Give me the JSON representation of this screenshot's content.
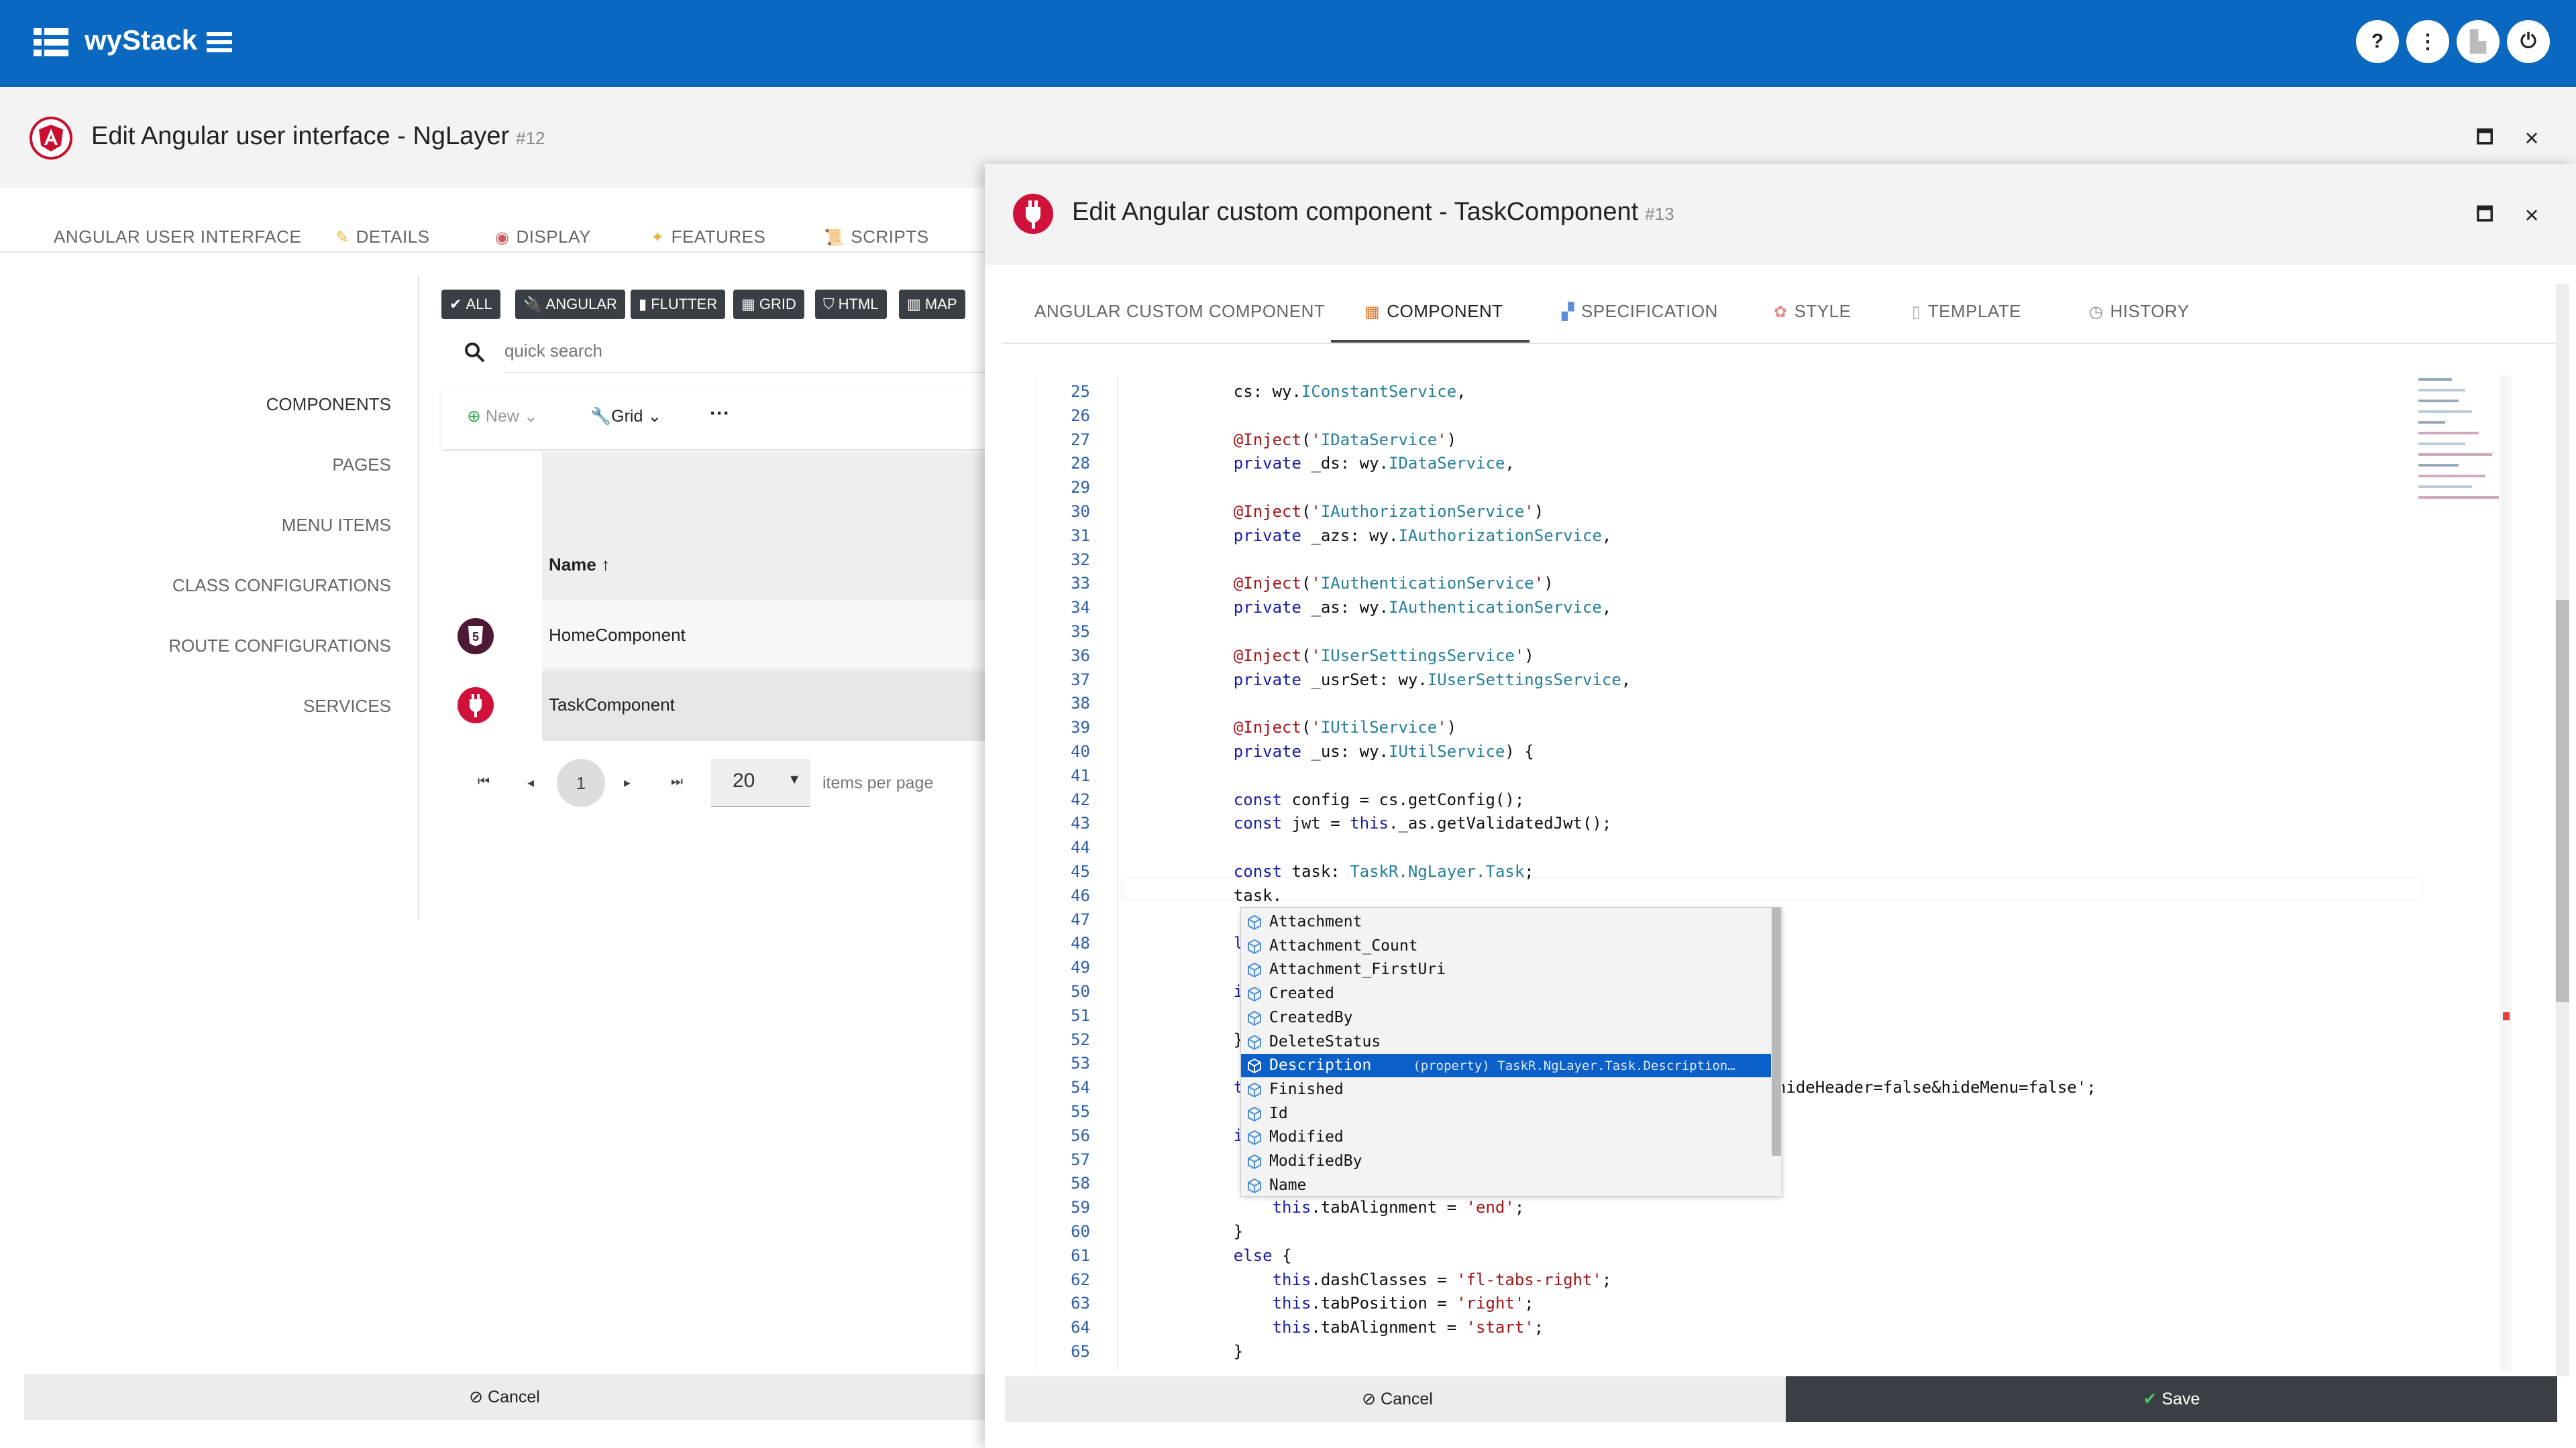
{
  "appbar": {
    "brand": "wyStack",
    "accent": "#0a68c0"
  },
  "bg": {
    "title": "Edit Angular user interface - NgLayer",
    "number": "#12",
    "tabs": [
      {
        "label": "ANGULAR USER INTERFACE",
        "icon": ""
      },
      {
        "label": "DETAILS",
        "icon": "pencil-icon"
      },
      {
        "label": "DISPLAY",
        "icon": "eye-icon"
      },
      {
        "label": "FEATURES",
        "icon": "sparkle-icon"
      },
      {
        "label": "SCRIPTS",
        "icon": "scroll-icon"
      }
    ],
    "sidebar": [
      "COMPONENTS",
      "PAGES",
      "MENU ITEMS",
      "CLASS CONFIGURATIONS",
      "ROUTE CONFIGURATIONS",
      "SERVICES"
    ],
    "filters": [
      "ALL",
      "ANGULAR",
      "FLUTTER",
      "GRID",
      "HTML",
      "MAP"
    ],
    "search_placeholder": "quick search",
    "toolbar": {
      "new": "New",
      "grid": "Grid",
      "more": "···"
    },
    "table": {
      "column": "Name",
      "sort_arrow": "↑",
      "rows": [
        {
          "name": "HomeComponent",
          "icon": "html5-icon"
        },
        {
          "name": "TaskComponent",
          "icon": "plug-icon"
        }
      ]
    },
    "pager": {
      "page": "1",
      "per_page": "20",
      "per_page_label": "items per page"
    },
    "cancel": "Cancel"
  },
  "fg": {
    "title": "Edit Angular custom component - TaskComponent",
    "number": "#13",
    "tabs": [
      {
        "label": "ANGULAR CUSTOM COMPONENT",
        "icon": ""
      },
      {
        "label": "COMPONENT",
        "icon": "grid-icon"
      },
      {
        "label": "SPECIFICATION",
        "icon": "blocks-icon"
      },
      {
        "label": "STYLE",
        "icon": "palette-icon"
      },
      {
        "label": "TEMPLATE",
        "icon": "page-icon"
      },
      {
        "label": "HISTORY",
        "icon": "clock-icon"
      }
    ],
    "code": [
      {
        "n": "25",
        "t": "    cs: wy.IConstantService,"
      },
      {
        "n": "26",
        "t": ""
      },
      {
        "n": "27",
        "t": "    @Inject('IDataService')"
      },
      {
        "n": "28",
        "t": "    private _ds: wy.IDataService,"
      },
      {
        "n": "29",
        "t": ""
      },
      {
        "n": "30",
        "t": "    @Inject('IAuthorizationService')"
      },
      {
        "n": "31",
        "t": "    private _azs: wy.IAuthorizationService,"
      },
      {
        "n": "32",
        "t": ""
      },
      {
        "n": "33",
        "t": "    @Inject('IAuthenticationService')"
      },
      {
        "n": "34",
        "t": "    private _as: wy.IAuthenticationService,"
      },
      {
        "n": "35",
        "t": ""
      },
      {
        "n": "36",
        "t": "    @Inject('IUserSettingsService')"
      },
      {
        "n": "37",
        "t": "    private _usrSet: wy.IUserSettingsService,"
      },
      {
        "n": "38",
        "t": ""
      },
      {
        "n": "39",
        "t": "    @Inject('IUtilService')"
      },
      {
        "n": "40",
        "t": "    private _us: wy.IUtilService) {"
      },
      {
        "n": "41",
        "t": ""
      },
      {
        "n": "42",
        "t": "    const config = cs.getConfig();"
      },
      {
        "n": "43",
        "t": "    const jwt = this._as.getValidatedJwt();"
      },
      {
        "n": "44",
        "t": ""
      },
      {
        "n": "45",
        "t": "    const task: TaskR.NgLayer.Task;"
      },
      {
        "n": "46",
        "t": "    task."
      },
      {
        "n": "47",
        "t": ""
      },
      {
        "n": "48",
        "t": "    let a"
      },
      {
        "n": "49",
        "t": ""
      },
      {
        "n": "50",
        "t": "    if (j"
      },
      {
        "n": "51",
        "t": "        a"
      },
      {
        "n": "52",
        "t": "    }"
      },
      {
        "n": "53",
        "t": ""
      },
      {
        "n": "54",
        "t": "    this.                                                d/?hideHeader=false&hideMenu=false';"
      },
      {
        "n": "55",
        "t": ""
      },
      {
        "n": "56",
        "t": "    if (t"
      },
      {
        "n": "57",
        "t": "        t"
      },
      {
        "n": "58",
        "t": "        t"
      },
      {
        "n": "59",
        "t": "        this.tabAlignment = 'end';"
      },
      {
        "n": "60",
        "t": "    }"
      },
      {
        "n": "61",
        "t": "    else {"
      },
      {
        "n": "62",
        "t": "        this.dashClasses = 'fl-tabs-right';"
      },
      {
        "n": "63",
        "t": "        this.tabPosition = 'right';"
      },
      {
        "n": "64",
        "t": "        this.tabAlignment = 'start';"
      },
      {
        "n": "65",
        "t": "    }"
      }
    ],
    "suggestions": [
      "Attachment",
      "Attachment_Count",
      "Attachment_FirstUri",
      "Created",
      "CreatedBy",
      "DeleteStatus",
      "Description",
      "Finished",
      "Id",
      "Modified",
      "ModifiedBy",
      "Name"
    ],
    "selected_detail": "(property) TaskR.NgLayer.Task.Description…",
    "cancel": "Cancel",
    "save": "Save"
  }
}
